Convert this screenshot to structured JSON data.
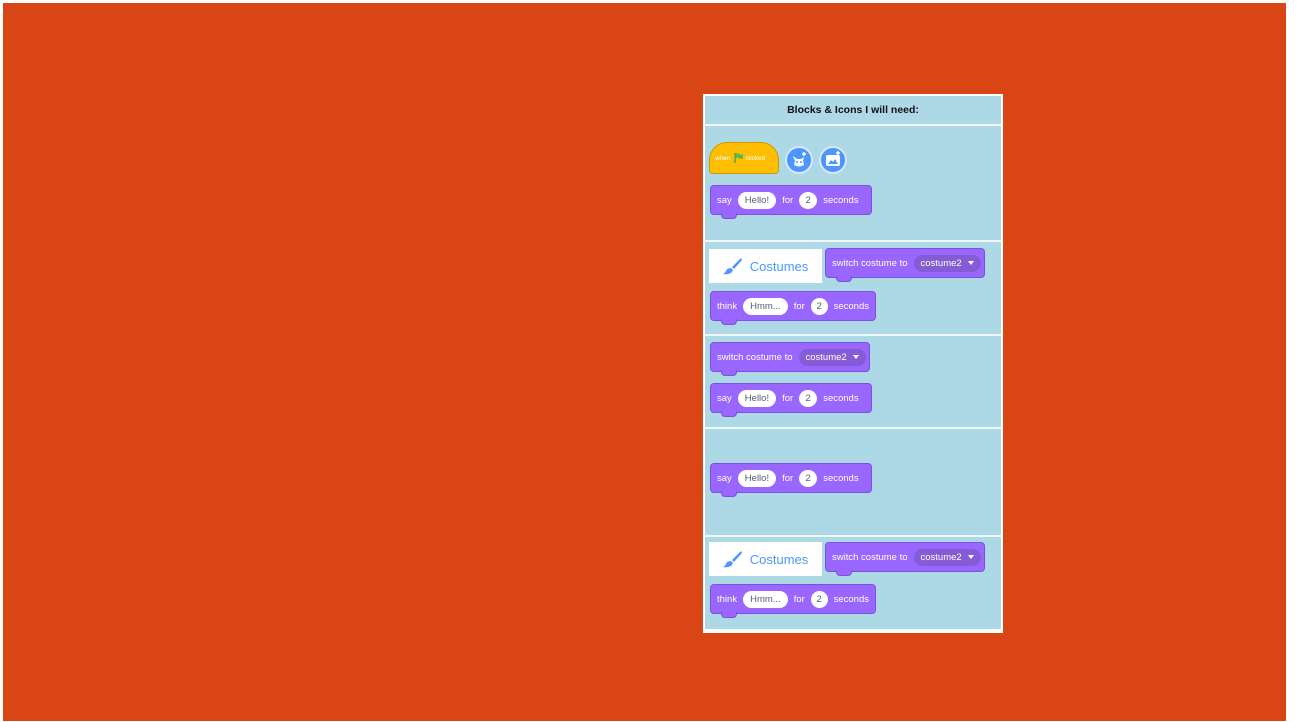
{
  "panel": {
    "title": "Blocks & Icons I will need:"
  },
  "hat_block": {
    "when": "when",
    "clicked": "clicked",
    "icon": "green-flag-icon"
  },
  "buttons": {
    "sprite_icon": "choose-sprite-icon",
    "backdrop_icon": "choose-backdrop-icon"
  },
  "tab": {
    "label": "Costumes",
    "icon": "paintbrush-icon"
  },
  "say_block": {
    "verb": "say",
    "message": "Hello!",
    "for": "for",
    "seconds_value": "2",
    "seconds": "seconds"
  },
  "think_block": {
    "verb": "think",
    "message": "Hmm...",
    "for": "for",
    "seconds_value": "2",
    "seconds": "seconds"
  },
  "switch_block": {
    "label": "switch costume to",
    "costume": "costume2"
  },
  "colors": {
    "background": "#d94515",
    "table": "#add8e6",
    "looks": "#9966ff",
    "events": "#ffbf00",
    "button": "#4c97ff"
  }
}
